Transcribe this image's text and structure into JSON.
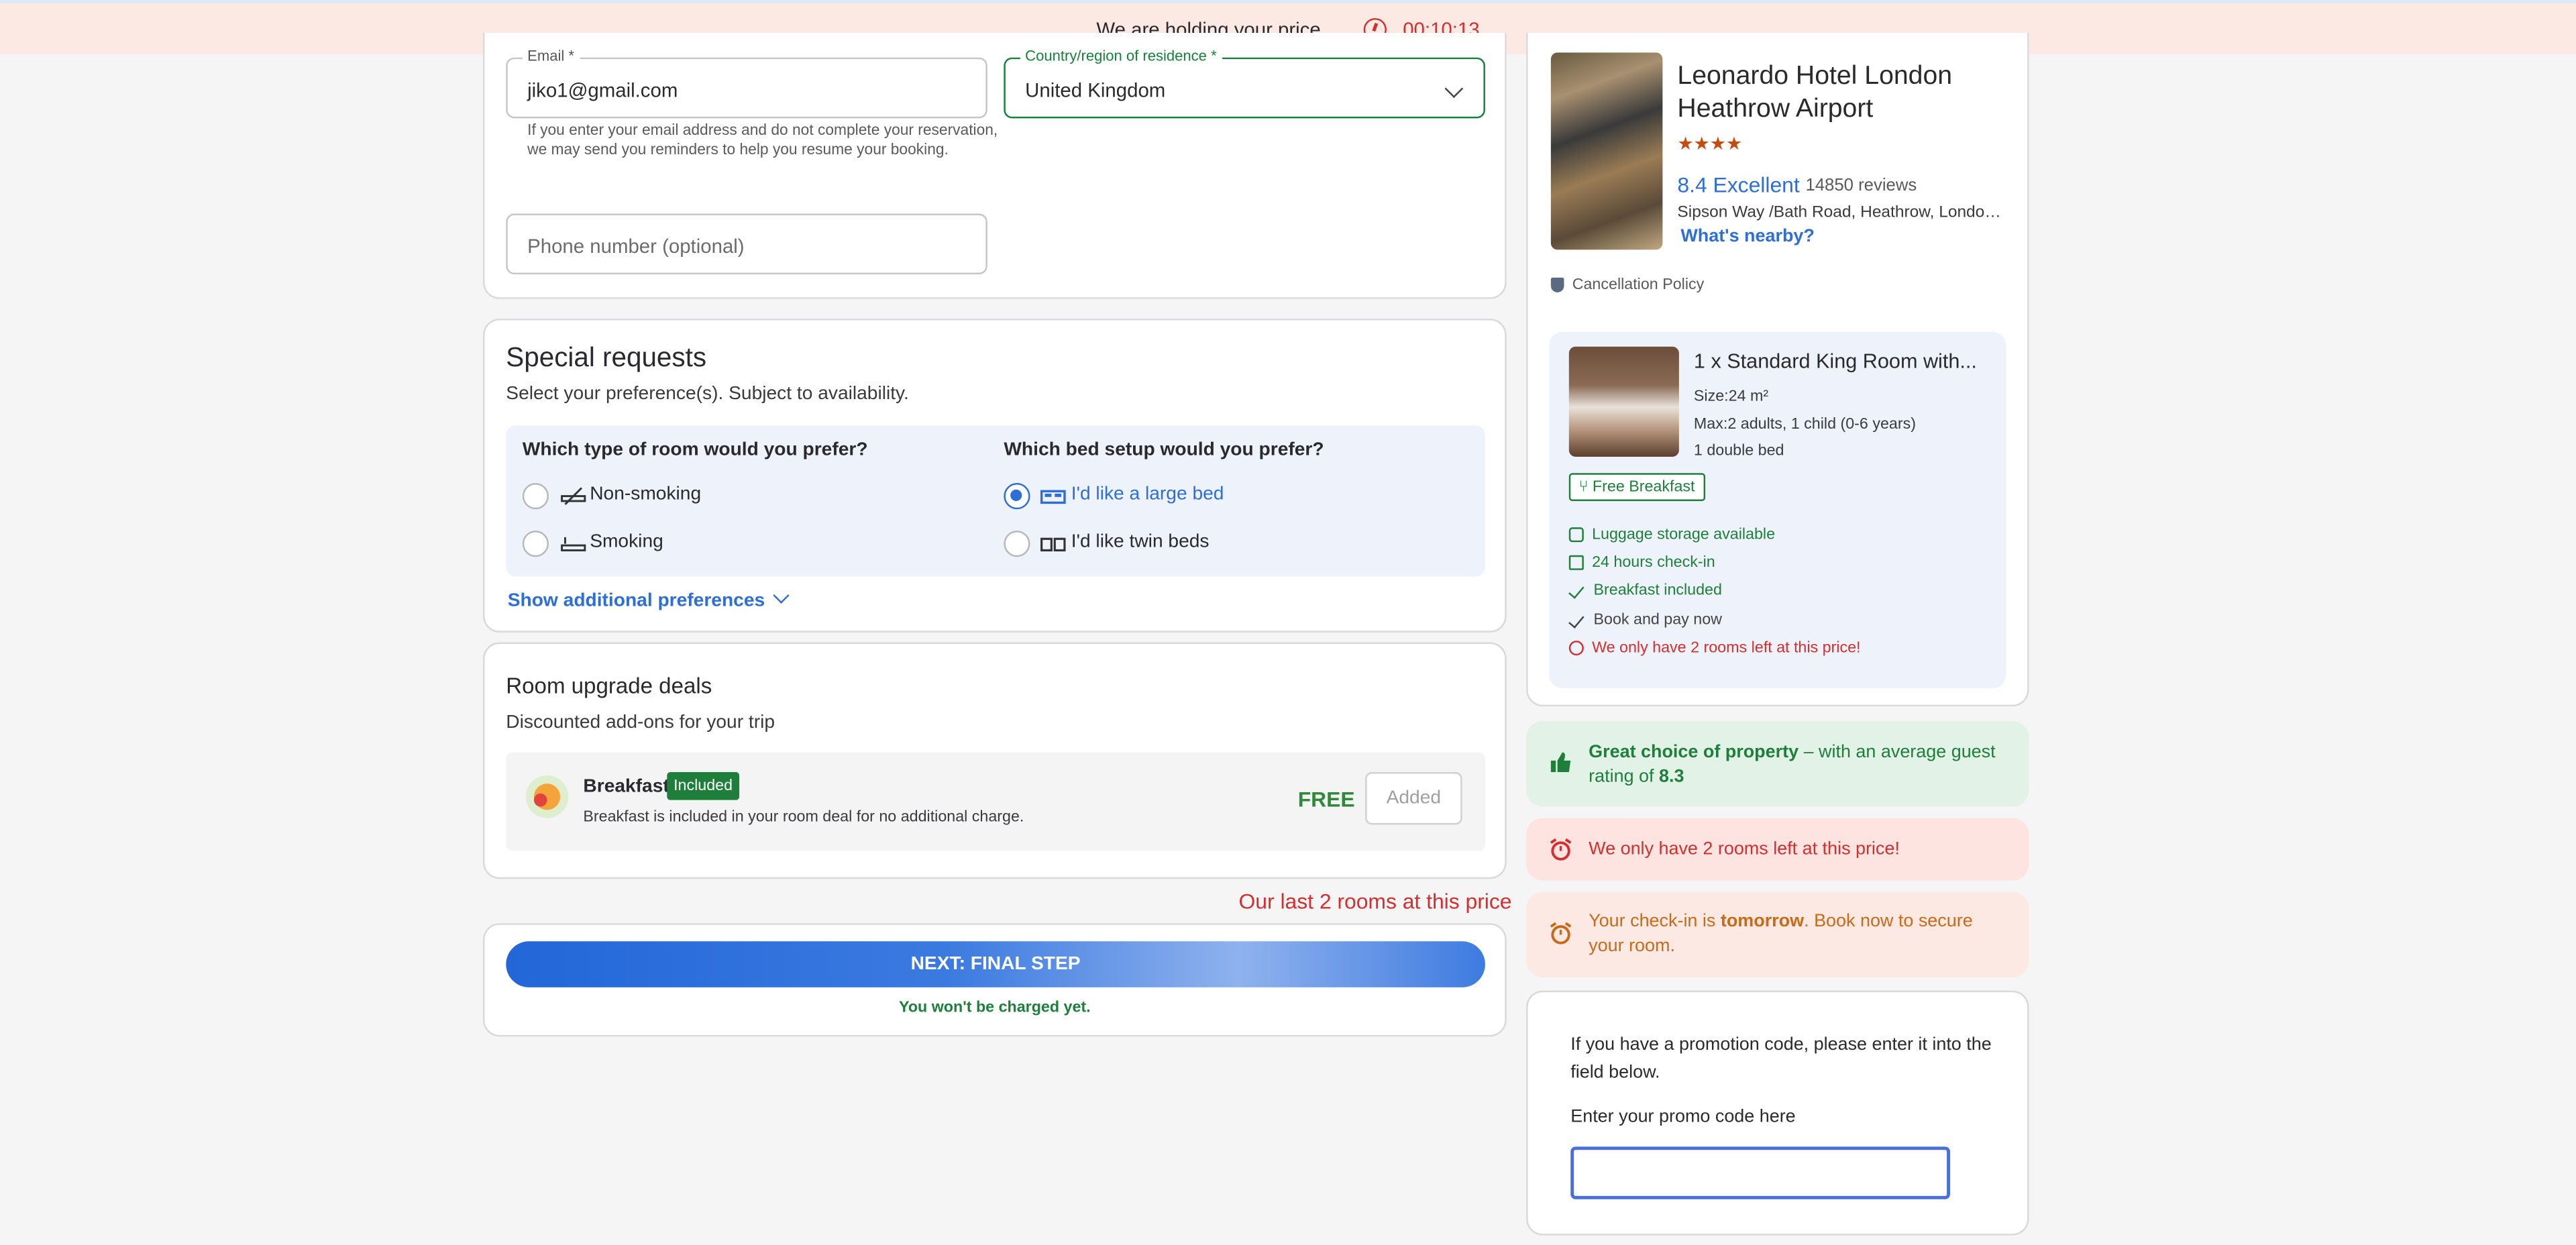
{
  "banner": {
    "text": "We are holding your price...",
    "timer": "00:10:13"
  },
  "contact": {
    "email_label": "Email *",
    "email_value": "jiko1@gmail.com",
    "email_hint": "If you enter your email address and do not complete your reservation, we may send you reminders to help you resume your booking.",
    "country_label": "Country/region of residence *",
    "country_value": "United Kingdom",
    "phone_placeholder": "Phone number (optional)"
  },
  "special": {
    "title": "Special requests",
    "subtitle": "Select your preference(s). Subject to availability.",
    "room_q": "Which type of room would you prefer?",
    "room_opts": [
      "Non-smoking",
      "Smoking"
    ],
    "bed_q": "Which bed setup would you prefer?",
    "bed_opts": [
      "I'd like a large bed",
      "I'd like twin beds"
    ],
    "show_more": "Show additional preferences"
  },
  "upgrade": {
    "title": "Room upgrade deals",
    "subtitle": "Discounted add-ons for your trip",
    "item_name": "Breakfast",
    "item_badge": "Included",
    "item_desc": "Breakfast is included in your room deal for no additional charge.",
    "price": "FREE",
    "button": "Added"
  },
  "urgency": "Our last 2 rooms at this price",
  "next": {
    "button": "NEXT: FINAL STEP",
    "note": "You won't be charged yet."
  },
  "hotel": {
    "name": "Leonardo Hotel London Heathrow Airport",
    "stars": "★★★★",
    "rating": "8.4 Excellent",
    "reviews": "14850 reviews",
    "address": "Sipson Way /Bath Road, Heathrow, London,...",
    "nearby": "What's nearby?",
    "cancellation": "Cancellation Policy",
    "room": {
      "title": "1 x Standard King Room with...",
      "size_label": "Size:",
      "size_value": "24 m²",
      "max_label": "Max:",
      "max_value": "2 adults, 1 child (0-6 years)",
      "beds": "1 double bed",
      "badge": "Free Breakfast",
      "features": [
        "Luggage storage available",
        "24 hours check-in",
        "Breakfast included",
        "Book and pay now",
        "We only have 2 rooms left at this price!"
      ]
    }
  },
  "alerts": {
    "great_bold": "Great choice of property",
    "great_rest": " – with an average guest rating of ",
    "great_score": "8.3",
    "limited": "We only have 2 rooms left at this price!",
    "checkin_pre": "Your check-in is ",
    "checkin_bold": "tomorrow",
    "checkin_post": ". Book now to secure your room."
  },
  "promo": {
    "text": "If you have a promotion code, please enter it into the field below.",
    "label": "Enter your promo code here",
    "value": ""
  },
  "colors": {
    "accent": "#2d6fd6",
    "success": "#1d7f3a",
    "danger": "#d42f2f",
    "warning": "#c96a18"
  }
}
